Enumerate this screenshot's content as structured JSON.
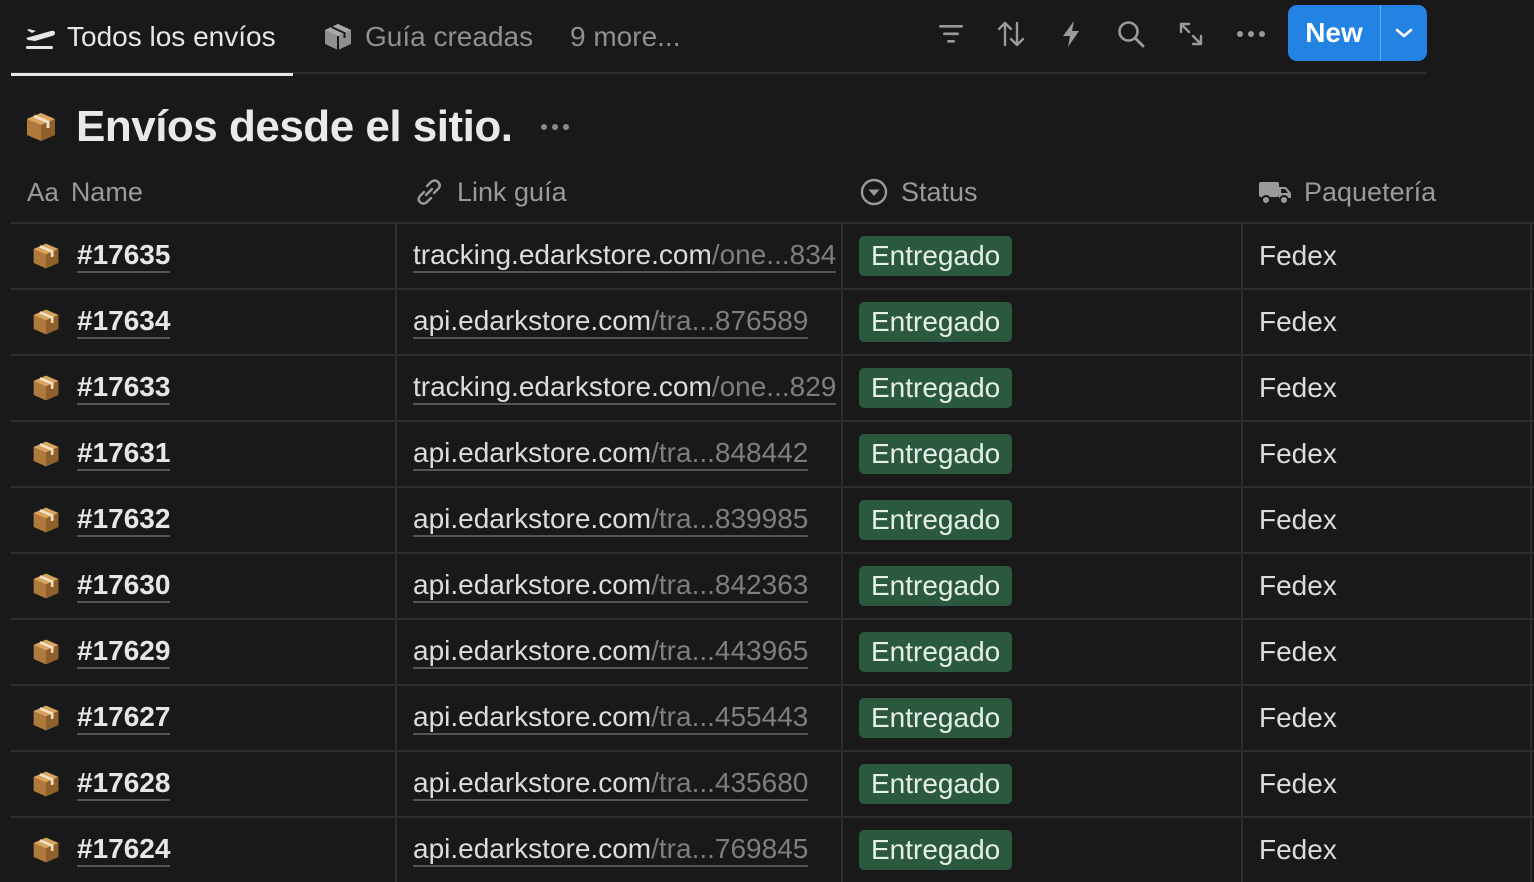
{
  "tabs": [
    {
      "label": "Todos los envíos",
      "icon": "airplane-icon",
      "active": true
    },
    {
      "label": "Guía creadas",
      "icon": "cube-icon",
      "active": false
    }
  ],
  "more_tabs_label": "9 more...",
  "toolbar": {
    "new_label": "New",
    "tools": [
      "filter-icon",
      "sort-icon",
      "lightning-icon",
      "search-icon",
      "expand-icon",
      "more-icon"
    ]
  },
  "page": {
    "title": "Envíos desde el sitio.",
    "emoji": "package-icon"
  },
  "columns": {
    "name": {
      "label": "Name",
      "type_label": "Aa"
    },
    "link": {
      "label": "Link guía",
      "icon": "link-icon"
    },
    "status": {
      "label": "Status",
      "icon": "status-icon"
    },
    "carrier": {
      "label": "Paquetería",
      "icon": "truck-icon"
    }
  },
  "rows": [
    {
      "name": "#17635",
      "link_host": "tracking.edarkstore.com",
      "link_rest": "/one...834",
      "status": "Entregado",
      "carrier": "Fedex"
    },
    {
      "name": "#17634",
      "link_host": "api.edarkstore.com",
      "link_rest": "/tra...876589",
      "status": "Entregado",
      "carrier": "Fedex"
    },
    {
      "name": "#17633",
      "link_host": "tracking.edarkstore.com",
      "link_rest": "/one...829",
      "status": "Entregado",
      "carrier": "Fedex"
    },
    {
      "name": "#17631",
      "link_host": "api.edarkstore.com",
      "link_rest": "/tra...848442",
      "status": "Entregado",
      "carrier": "Fedex"
    },
    {
      "name": "#17632",
      "link_host": "api.edarkstore.com",
      "link_rest": "/tra...839985",
      "status": "Entregado",
      "carrier": "Fedex"
    },
    {
      "name": "#17630",
      "link_host": "api.edarkstore.com",
      "link_rest": "/tra...842363",
      "status": "Entregado",
      "carrier": "Fedex"
    },
    {
      "name": "#17629",
      "link_host": "api.edarkstore.com",
      "link_rest": "/tra...443965",
      "status": "Entregado",
      "carrier": "Fedex"
    },
    {
      "name": "#17627",
      "link_host": "api.edarkstore.com",
      "link_rest": "/tra...455443",
      "status": "Entregado",
      "carrier": "Fedex"
    },
    {
      "name": "#17628",
      "link_host": "api.edarkstore.com",
      "link_rest": "/tra...435680",
      "status": "Entregado",
      "carrier": "Fedex"
    },
    {
      "name": "#17624",
      "link_host": "api.edarkstore.com",
      "link_rest": "/tra...769845",
      "status": "Entregado",
      "carrier": "Fedex"
    }
  ],
  "colors": {
    "background": "#191919",
    "accent": "#2383e2",
    "status_green": "#2b593f",
    "grid_line": "#2e2e2e"
  }
}
